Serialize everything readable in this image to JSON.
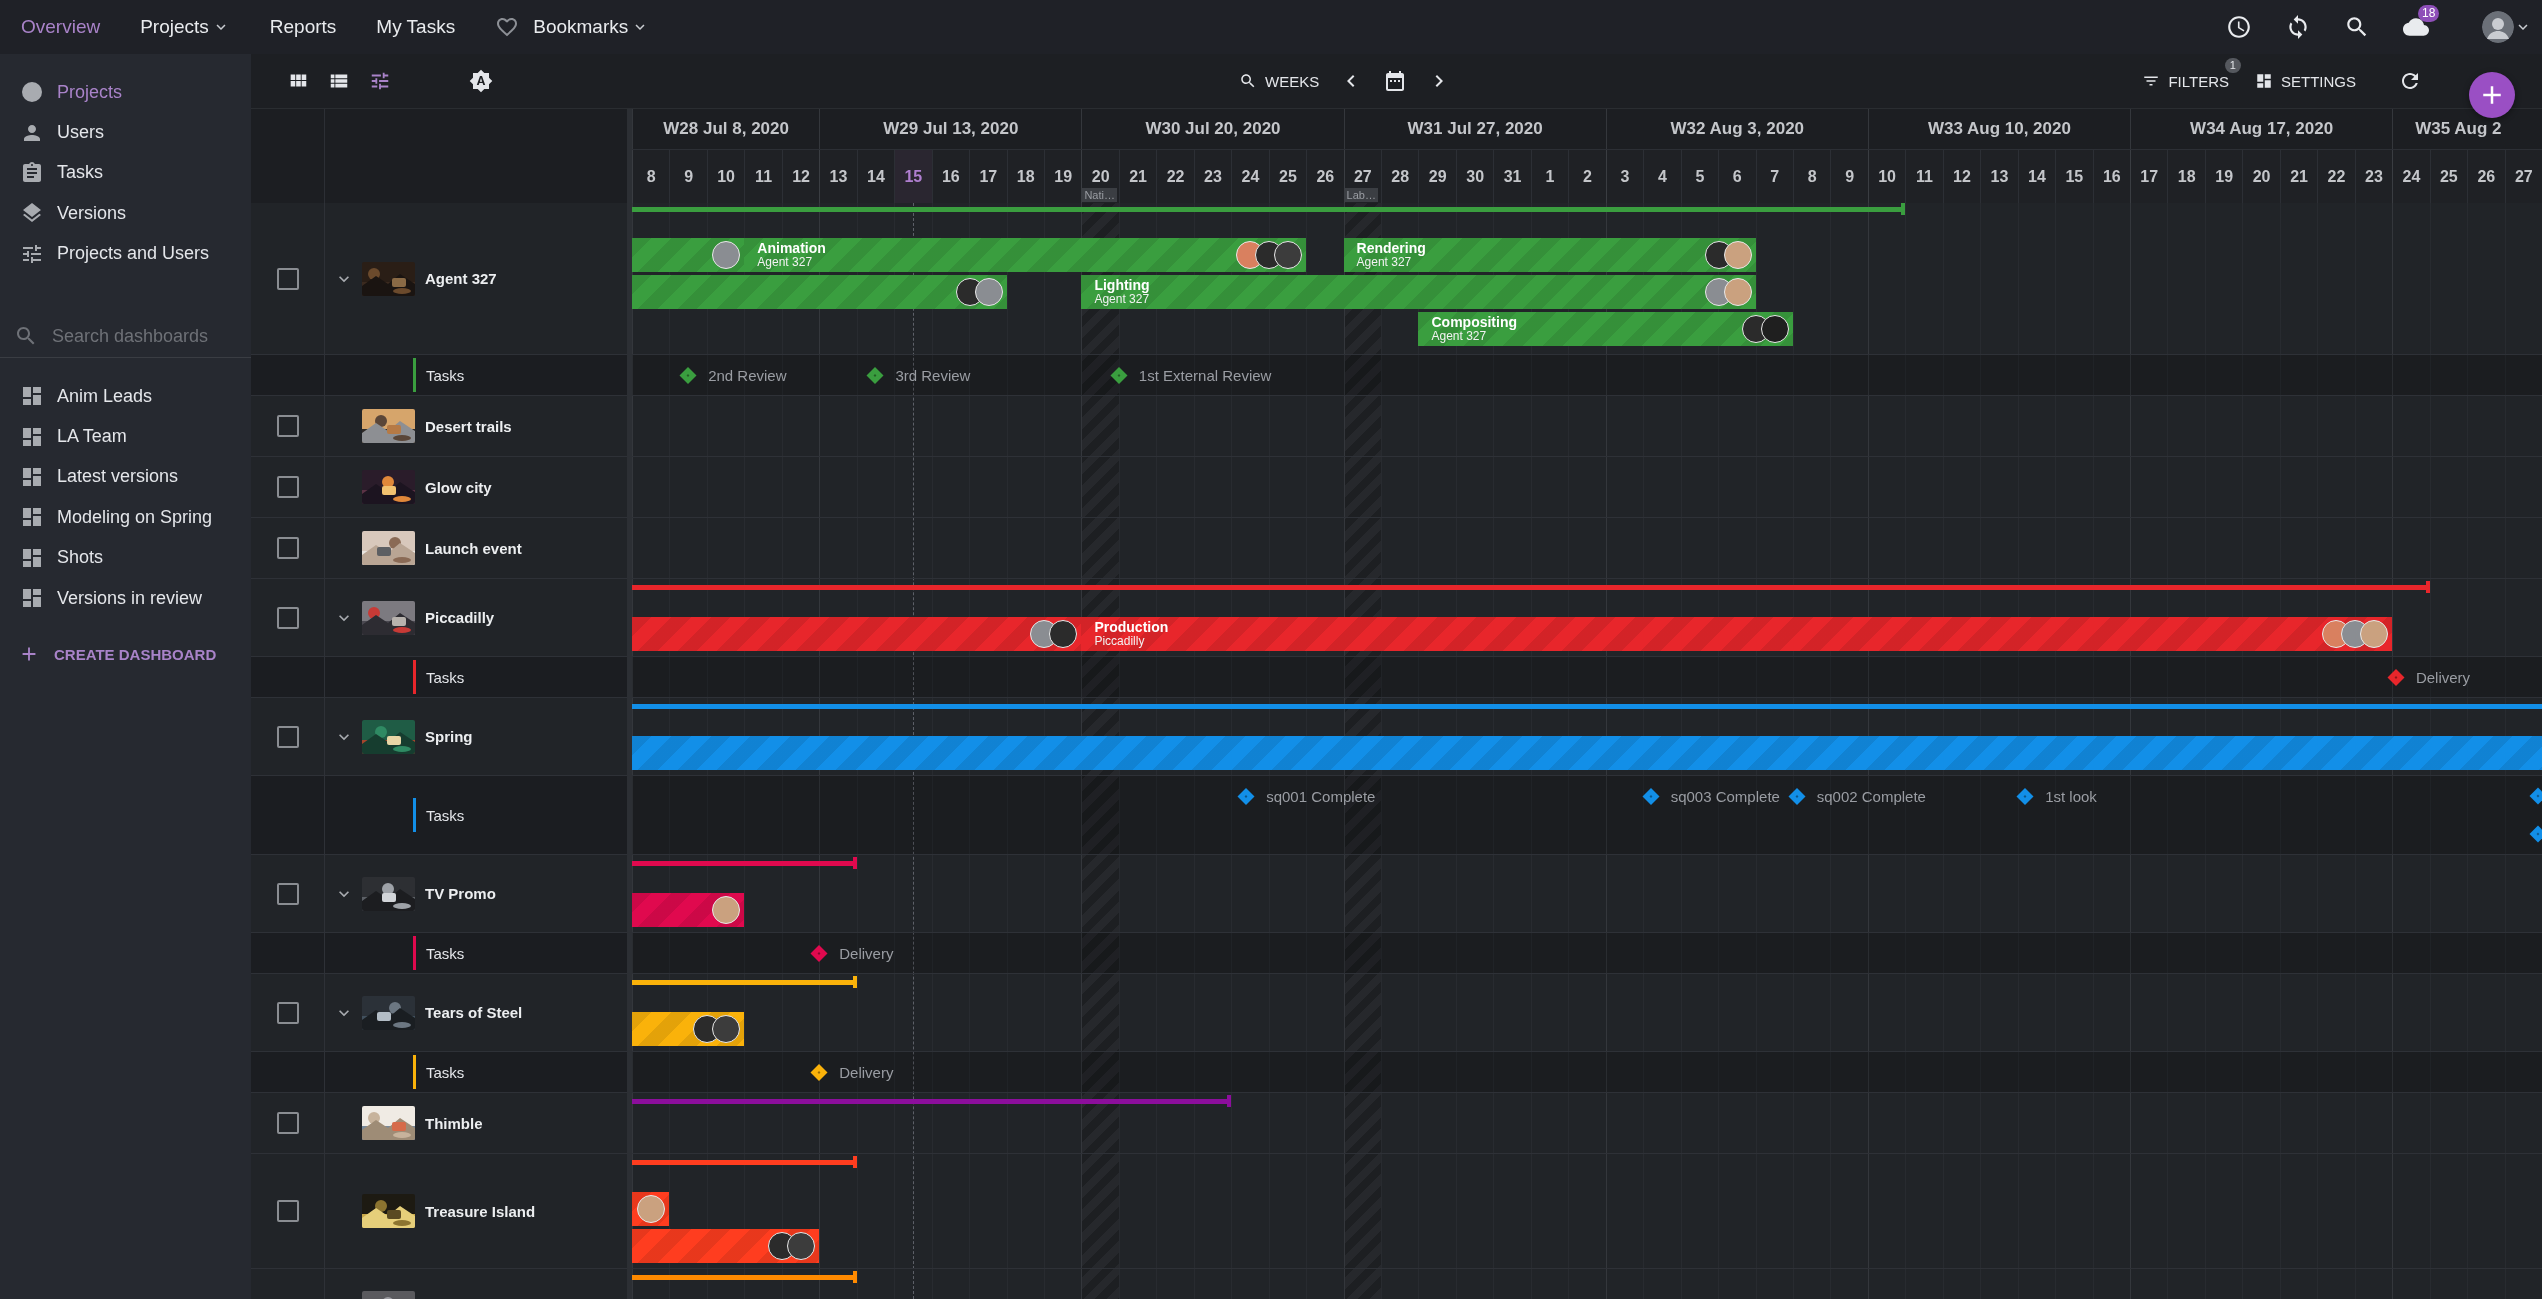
{
  "top_nav": {
    "items": [
      {
        "label": "Overview",
        "kind": "link",
        "selected": true
      },
      {
        "label": "Projects",
        "kind": "menu",
        "selected": false
      },
      {
        "label": "Reports",
        "kind": "link",
        "selected": false
      },
      {
        "label": "My Tasks",
        "kind": "link",
        "selected": false
      },
      {
        "label": "Bookmarks",
        "kind": "bookmarks",
        "selected": false
      }
    ],
    "notifications_badge": "18"
  },
  "sidebar": {
    "items": [
      {
        "label": "Projects",
        "selected": true
      },
      {
        "label": "Users",
        "selected": false
      },
      {
        "label": "Tasks",
        "selected": false
      },
      {
        "label": "Versions",
        "selected": false
      },
      {
        "label": "Projects and Users",
        "selected": false
      }
    ],
    "search": {
      "placeholder": "Search dashboards"
    },
    "dashboards": [
      {
        "label": "Anim Leads"
      },
      {
        "label": "LA Team"
      },
      {
        "label": "Latest versions"
      },
      {
        "label": "Modeling on Spring"
      },
      {
        "label": "Shots"
      },
      {
        "label": "Versions in review"
      }
    ],
    "create_label": "CREATE DASHBOARD"
  },
  "toolbar": {
    "views": [
      {
        "selected": false
      },
      {
        "selected": false
      },
      {
        "selected": true
      }
    ],
    "zoom_label": "WEEKS",
    "filters_label": "FILTERS",
    "filters_badge": "1",
    "settings_label": "SETTINGS"
  },
  "timeline": {
    "weeks": [
      {
        "label": "W28 Jul 8, 2020",
        "days": [
          {
            "label": "8",
            "today": false
          },
          {
            "label": "9",
            "today": false
          },
          {
            "label": "10",
            "today": false
          },
          {
            "label": "11",
            "today": false
          },
          {
            "label": "12",
            "today": false
          }
        ]
      },
      {
        "label": "W29 Jul 13, 2020",
        "days": [
          {
            "label": "13",
            "today": false
          },
          {
            "label": "14",
            "today": false
          },
          {
            "label": "15",
            "today": true
          },
          {
            "label": "16",
            "today": false
          },
          {
            "label": "17",
            "today": false
          },
          {
            "label": "18",
            "today": false
          },
          {
            "label": "19",
            "today": false
          }
        ]
      },
      {
        "label": "W30 Jul 20, 2020",
        "days": [
          {
            "label": "20",
            "today": false,
            "holiday": "Nati…"
          },
          {
            "label": "21",
            "today": false
          },
          {
            "label": "22",
            "today": false
          },
          {
            "label": "23",
            "today": false
          },
          {
            "label": "24",
            "today": false
          },
          {
            "label": "25",
            "today": false
          },
          {
            "label": "26",
            "today": false
          }
        ]
      },
      {
        "label": "W31 Jul 27, 2020",
        "days": [
          {
            "label": "27",
            "today": false,
            "holiday": "Lab…"
          },
          {
            "label": "28",
            "today": false
          },
          {
            "label": "29",
            "today": false
          },
          {
            "label": "30",
            "today": false
          },
          {
            "label": "31",
            "today": false
          },
          {
            "label": "1",
            "today": false
          },
          {
            "label": "2",
            "today": false
          }
        ]
      },
      {
        "label": "W32 Aug 3, 2020",
        "days": [
          {
            "label": "3",
            "today": false
          },
          {
            "label": "4",
            "today": false
          },
          {
            "label": "5",
            "today": false
          },
          {
            "label": "6",
            "today": false
          },
          {
            "label": "7",
            "today": false
          },
          {
            "label": "8",
            "today": false
          },
          {
            "label": "9",
            "today": false
          }
        ]
      },
      {
        "label": "W33 Aug 10, 2020",
        "days": [
          {
            "label": "10",
            "today": false
          },
          {
            "label": "11",
            "today": false
          },
          {
            "label": "12",
            "today": false
          },
          {
            "label": "13",
            "today": false
          },
          {
            "label": "14",
            "today": false
          },
          {
            "label": "15",
            "today": false
          },
          {
            "label": "16",
            "today": false
          }
        ]
      },
      {
        "label": "W34 Aug 17, 2020",
        "days": [
          {
            "label": "17",
            "today": false
          },
          {
            "label": "18",
            "today": false
          },
          {
            "label": "19",
            "today": false
          },
          {
            "label": "20",
            "today": false
          },
          {
            "label": "21",
            "today": false
          },
          {
            "label": "22",
            "today": false
          },
          {
            "label": "23",
            "today": false
          }
        ]
      },
      {
        "label": "W35 Aug 2",
        "days": [
          {
            "label": "24",
            "today": false
          },
          {
            "label": "25",
            "today": false
          },
          {
            "label": "26",
            "today": false
          },
          {
            "label": "27",
            "today": false
          }
        ]
      }
    ]
  },
  "projects": [
    {
      "name": "Agent 327",
      "checked": false,
      "expanded": true,
      "thumbnail": {
        "kind": "picture"
      },
      "color": "#3a9e3f",
      "lanes": [
        [
          {
            "kind": "bar",
            "avatars": [
              {
                "color": "#8a8d92"
              }
            ]
          },
          {
            "kind": "bar",
            "title": "Animation",
            "subtitle": "Agent 327",
            "avatars": [
              {
                "color": "#d9805f"
              },
              {
                "color": "#2b2b2b"
              },
              {
                "color": "#3c3c3c"
              }
            ]
          },
          {
            "kind": "bar",
            "title": "Rendering",
            "subtitle": "Agent 327",
            "avatars": [
              {
                "color": "#2b2b2b"
              },
              {
                "color": "#caa17f"
              }
            ]
          }
        ],
        [
          {
            "kind": "bar",
            "avatars": [
              {
                "color": "#2b2b2b"
              },
              {
                "color": "#8a8d92"
              }
            ]
          },
          {
            "kind": "bar",
            "title": "Lighting",
            "subtitle": "Agent 327",
            "avatars": [
              {
                "color": "#8a8d92"
              },
              {
                "color": "#caa17f"
              }
            ]
          }
        ],
        [
          {
            "kind": "bar",
            "title": "Compositing",
            "subtitle": "Agent 327",
            "avatars": [
              {
                "color": "#2b2b2b"
              },
              {
                "color": "#1f1f1f"
              }
            ]
          }
        ]
      ],
      "tasks": {
        "label": "Tasks",
        "lanes": [
          [
            {
              "kind": "milestone",
              "name": "2nd Review"
            },
            {
              "kind": "milestone",
              "name": "3rd Review"
            },
            {
              "kind": "milestone",
              "name": "1st External Review"
            }
          ]
        ]
      }
    },
    {
      "name": "Desert trails",
      "checked": false,
      "thumbnail": {
        "kind": "picture"
      }
    },
    {
      "name": "Glow city",
      "checked": false,
      "thumbnail": {
        "kind": "picture"
      }
    },
    {
      "name": "Launch event",
      "checked": false,
      "thumbnail": {
        "kind": "picture"
      }
    },
    {
      "name": "Piccadilly",
      "checked": false,
      "expanded": true,
      "thumbnail": {
        "kind": "picture"
      },
      "color": "#e8262b",
      "lanes": [
        [
          {
            "kind": "bar",
            "avatars": [
              {
                "color": "#8a8d92"
              },
              {
                "color": "#2b2b2b"
              }
            ]
          },
          {
            "kind": "bar",
            "title": "Production",
            "subtitle": "Piccadilly",
            "avatars": [
              {
                "color": "#d9805f"
              },
              {
                "color": "#8a8d92"
              },
              {
                "color": "#caa17f"
              }
            ]
          }
        ]
      ],
      "tasks": {
        "label": "Tasks",
        "lanes": [
          [
            {
              "kind": "milestone",
              "name": "Delivery"
            }
          ]
        ]
      }
    },
    {
      "name": "Spring",
      "checked": false,
      "expanded": true,
      "thumbnail": {
        "kind": "picture"
      },
      "color": "#128fe8",
      "lanes": [
        [
          {
            "kind": "bar"
          }
        ]
      ],
      "tasks": {
        "label": "Tasks",
        "lanes": [
          [
            {
              "kind": "milestone",
              "name": "sq001 Complete"
            },
            {
              "kind": "milestone",
              "name": "sq003 Complete"
            },
            {
              "kind": "milestone",
              "name": "sq002 Complete"
            },
            {
              "kind": "milestone",
              "name": "1st look"
            },
            {
              "kind": "milestone"
            }
          ],
          [
            {
              "kind": "milestone"
            }
          ]
        ]
      }
    },
    {
      "name": "TV Promo",
      "checked": false,
      "expanded": true,
      "thumbnail": {
        "kind": "picture"
      },
      "color": "#e0094e",
      "lanes": [
        [
          {
            "kind": "bar",
            "avatars": [
              {
                "color": "#caa17f"
              }
            ]
          }
        ]
      ],
      "tasks": {
        "label": "Tasks",
        "lanes": [
          [
            {
              "kind": "milestone",
              "name": "Delivery"
            }
          ]
        ]
      }
    },
    {
      "name": "Tears of Steel",
      "checked": false,
      "expanded": true,
      "thumbnail": {
        "kind": "picture"
      },
      "color": "#fab20a",
      "lanes": [
        [
          {
            "kind": "bar",
            "avatars": [
              {
                "color": "#2b2b2b"
              },
              {
                "color": "#3c3c3c"
              }
            ]
          }
        ]
      ],
      "tasks": {
        "label": "Tasks",
        "lanes": [
          [
            {
              "kind": "milestone",
              "name": "Delivery"
            }
          ]
        ]
      }
    },
    {
      "name": "Thimble",
      "checked": false,
      "thumbnail": {
        "kind": "picture"
      },
      "color": "#8c0e9c"
    },
    {
      "name": "Treasure Island",
      "checked": false,
      "thumbnail": {
        "kind": "picture"
      },
      "color": "#ff3d1f",
      "lanes": [
        [
          {
            "kind": "bar",
            "avatars": [
              {
                "color": "#caa17f"
              }
            ]
          }
        ],
        [
          {
            "kind": "bar",
            "avatars": [
              {
                "color": "#2b2b2b"
              },
              {
                "color": "#3c3c3c"
              }
            ]
          }
        ]
      ]
    },
    {
      "thumbnail": {
        "kind": "picture"
      },
      "color": "#ff8a00"
    }
  ]
}
